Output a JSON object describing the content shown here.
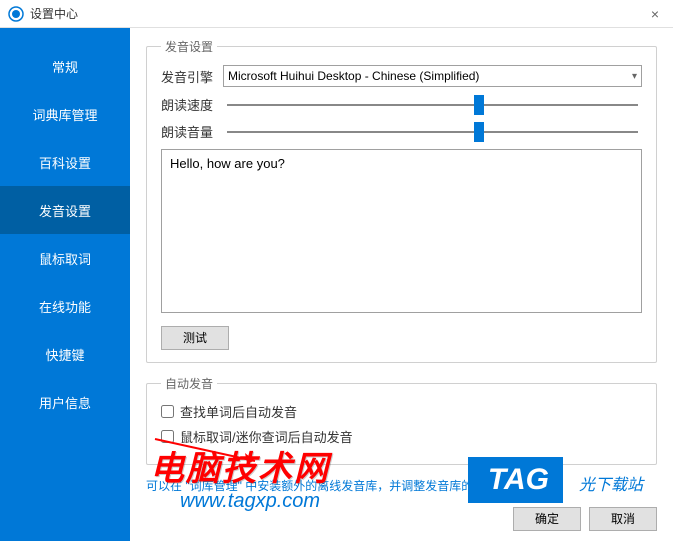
{
  "titlebar": {
    "title": "设置中心",
    "close_label": "×"
  },
  "sidebar": {
    "items": [
      {
        "label": "常规"
      },
      {
        "label": "词典库管理"
      },
      {
        "label": "百科设置"
      },
      {
        "label": "发音设置"
      },
      {
        "label": "鼠标取词"
      },
      {
        "label": "在线功能"
      },
      {
        "label": "快捷键"
      },
      {
        "label": "用户信息"
      }
    ],
    "selected_index": 3
  },
  "voice_settings": {
    "legend": "发音设置",
    "engine_label": "发音引擎",
    "engine_value": "Microsoft Huihui Desktop - Chinese (Simplified)",
    "speed_label": "朗读速度",
    "speed_value": 60,
    "volume_label": "朗读音量",
    "volume_value": 60,
    "test_text": "Hello, how are you?",
    "test_button": "测试"
  },
  "auto_voice": {
    "legend": "自动发音",
    "check1": "查找单词后自动发音",
    "check2": "鼠标取词/迷你查词后自动发音"
  },
  "hint": {
    "prefix": "可以在",
    "quoted": "\"词库管理\"",
    "suffix": "中安装额外的离线发音库，并调整发音库的顺序"
  },
  "footer": {
    "ok": "确定",
    "cancel": "取消"
  },
  "overlay": {
    "red": "电脑技术网",
    "blue": "www.tagxp.com",
    "tag": "TAG",
    "tag_text": "光下载站"
  }
}
